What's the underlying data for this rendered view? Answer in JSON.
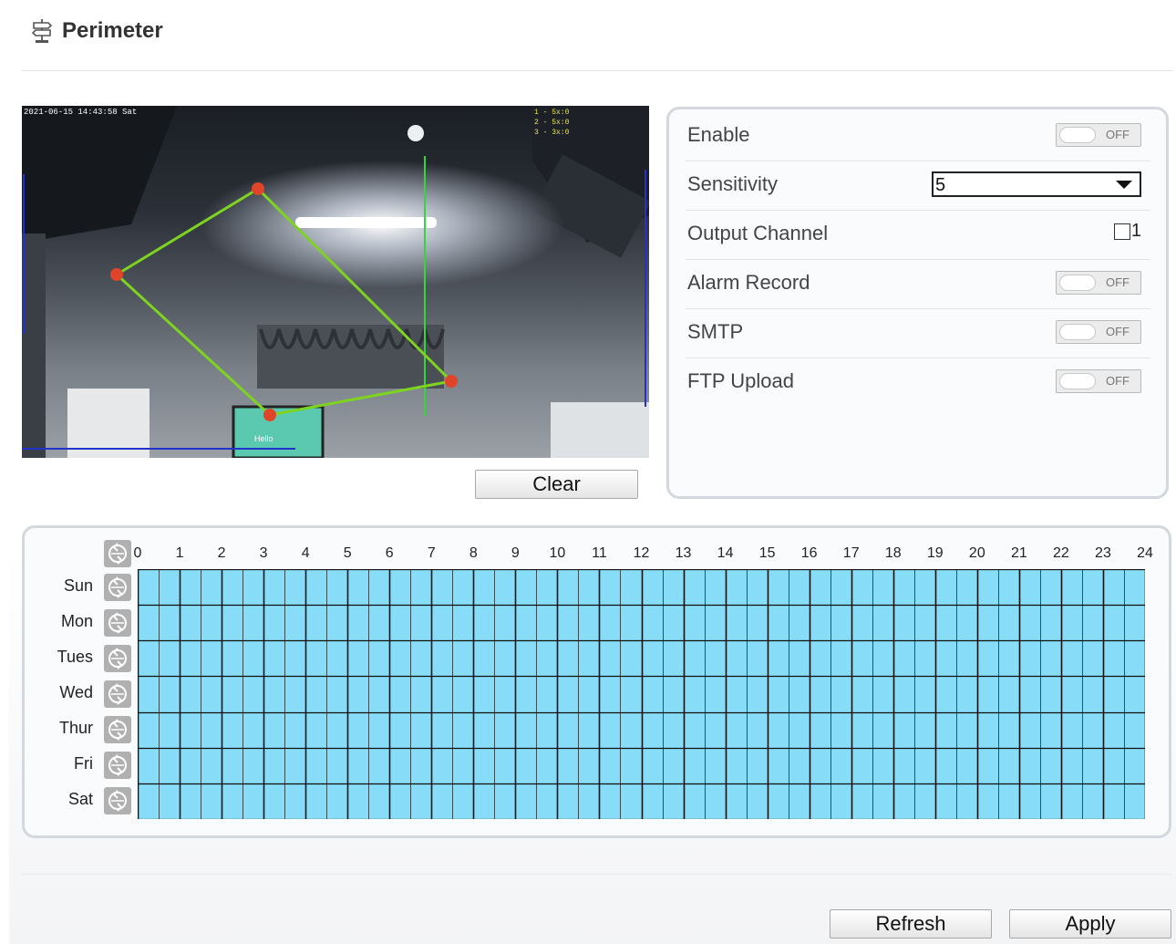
{
  "header": {
    "title": "Perimeter",
    "icon": "perimeter-icon"
  },
  "video": {
    "timestamp": "2021-06-15 14:43:58 Sat",
    "overlay_lines": [
      "1 - 5x:0",
      "2 - 5x:0",
      "3 - 3x:0"
    ],
    "screen_text": "Hello",
    "region_color": "#7ed321",
    "vertex_color": "#e0452a"
  },
  "buttons": {
    "clear": "Clear",
    "refresh": "Refresh",
    "apply": "Apply"
  },
  "settings": {
    "enable": {
      "label": "Enable",
      "state": "OFF"
    },
    "sensitivity": {
      "label": "Sensitivity",
      "value": "5"
    },
    "output_channel": {
      "label": "Output Channel",
      "option": "1",
      "checked": false
    },
    "alarm_record": {
      "label": "Alarm Record",
      "state": "OFF"
    },
    "smtp": {
      "label": "SMTP",
      "state": "OFF"
    },
    "ftp_upload": {
      "label": "FTP Upload",
      "state": "OFF"
    }
  },
  "schedule": {
    "hours": [
      "0",
      "1",
      "2",
      "3",
      "4",
      "5",
      "6",
      "7",
      "8",
      "9",
      "10",
      "11",
      "12",
      "13",
      "14",
      "15",
      "16",
      "17",
      "18",
      "19",
      "20",
      "21",
      "22",
      "23",
      "24"
    ],
    "days": [
      "Sun",
      "Mon",
      "Tues",
      "Wed",
      "Thur",
      "Fri",
      "Sat"
    ],
    "cell_color": "#87ddf7",
    "all_selected": true
  }
}
